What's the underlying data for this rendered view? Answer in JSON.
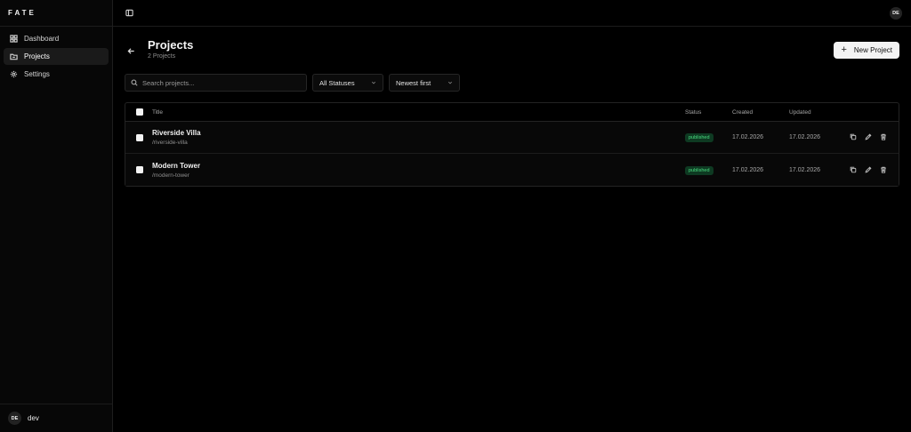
{
  "brand": "FATE",
  "sidebar": {
    "items": [
      {
        "label": "Dashboard",
        "icon": "dashboard-icon",
        "active": false
      },
      {
        "label": "Projects",
        "icon": "folder-icon",
        "active": true
      },
      {
        "label": "Settings",
        "icon": "gear-icon",
        "active": false
      }
    ],
    "user": {
      "initials": "DE",
      "name": "dev"
    }
  },
  "topbar": {
    "avatar_initials": "DE"
  },
  "page": {
    "title": "Projects",
    "subtitle": "2 Projects",
    "new_button_label": "New Project"
  },
  "filters": {
    "search_placeholder": "Search projects...",
    "status_value": "All Statuses",
    "sort_value": "Newest first"
  },
  "table": {
    "columns": {
      "title": "Title",
      "status": "Status",
      "created": "Created",
      "updated": "Updated"
    },
    "rows": [
      {
        "title": "Riverside Villa",
        "slug": "/riverside-villa",
        "status": "published",
        "created": "17.02.2026",
        "updated": "17.02.2026"
      },
      {
        "title": "Modern Tower",
        "slug": "/modern-tower",
        "status": "published",
        "created": "17.02.2026",
        "updated": "17.02.2026"
      }
    ]
  },
  "colors": {
    "accent": "#4ade80",
    "badge_bg": "#0e3a22",
    "background": "#000000"
  }
}
